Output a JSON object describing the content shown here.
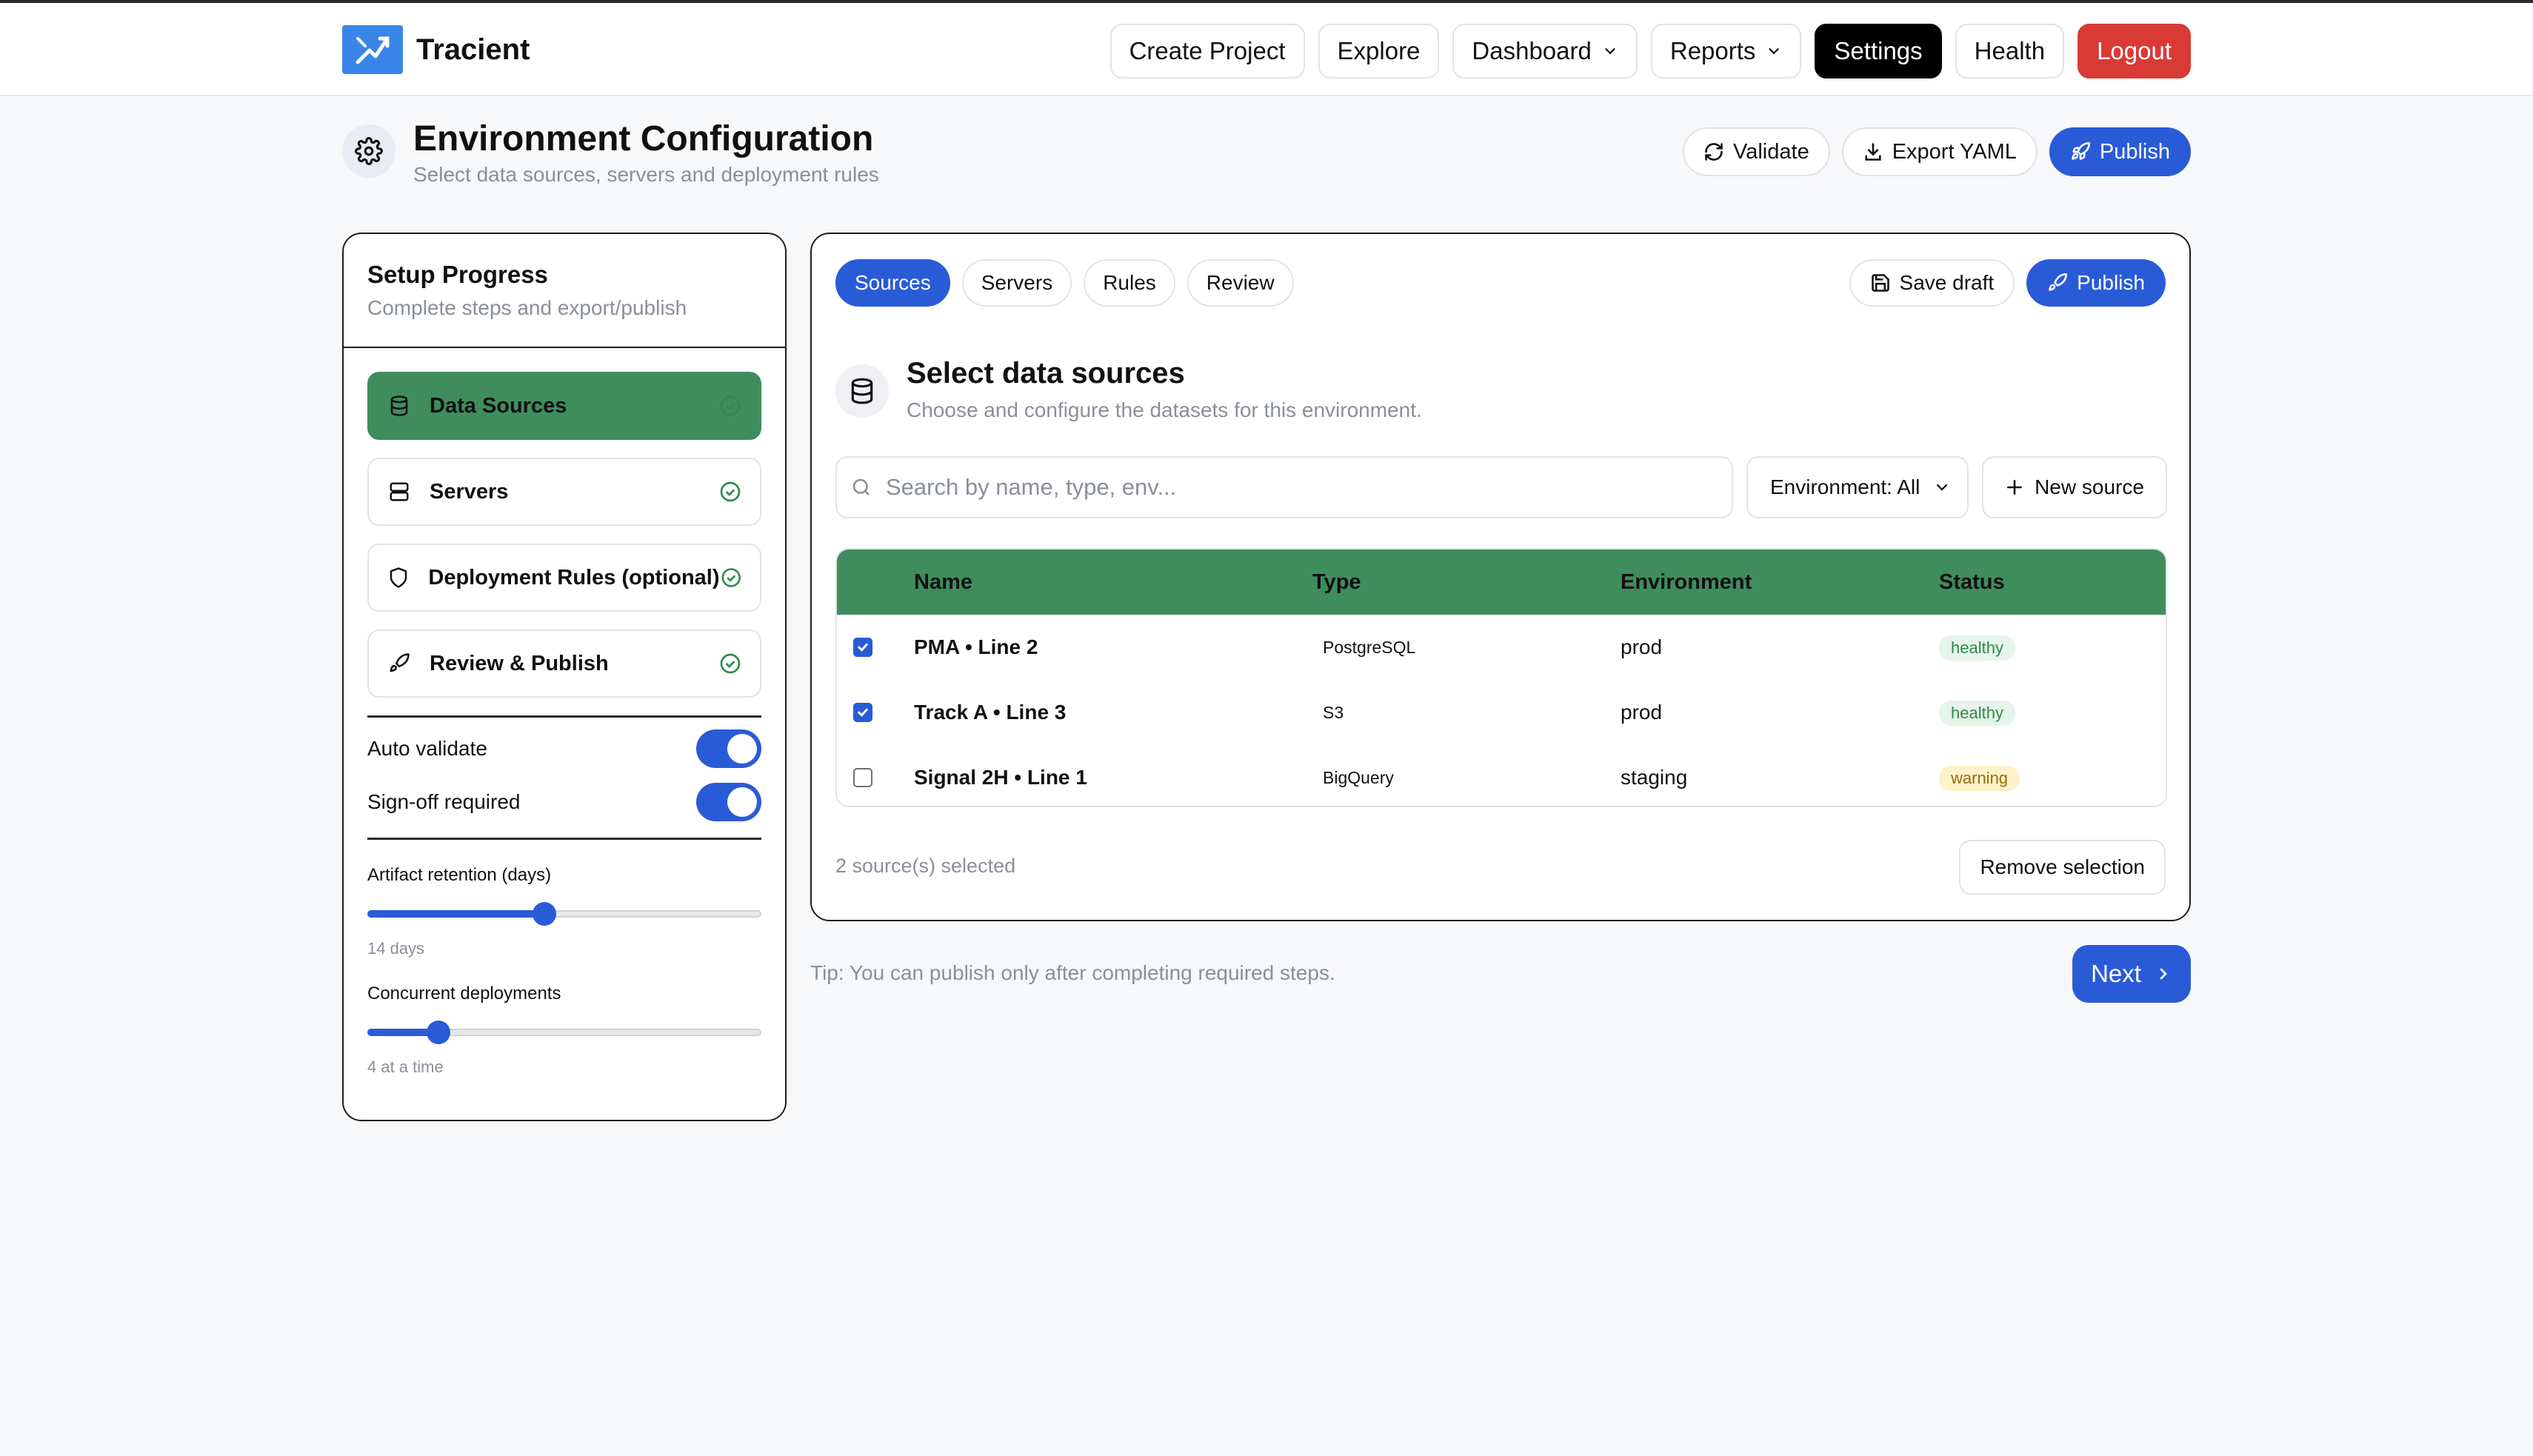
{
  "app": {
    "name": "Tracient"
  },
  "nav": {
    "create_project": "Create Project",
    "explore": "Explore",
    "dashboard": "Dashboard",
    "reports": "Reports",
    "settings": "Settings",
    "health": "Health",
    "logout": "Logout"
  },
  "page": {
    "title": "Environment Configuration",
    "subtitle": "Select data sources, servers and deployment rules",
    "actions": {
      "validate": "Validate",
      "export": "Export YAML",
      "publish": "Publish"
    }
  },
  "setup": {
    "title": "Setup Progress",
    "subtitle": "Complete steps and export/publish",
    "steps": [
      {
        "label": "Data Sources",
        "icon": "database-icon",
        "done": true,
        "active": true
      },
      {
        "label": "Servers",
        "icon": "server-icon",
        "done": true,
        "active": false
      },
      {
        "label": "Deployment Rules (optional)",
        "icon": "shield-icon",
        "done": true,
        "active": false
      },
      {
        "label": "Review & Publish",
        "icon": "rocket-icon",
        "done": true,
        "active": false
      }
    ],
    "toggles": {
      "auto_validate": "Auto validate",
      "signoff": "Sign-off required"
    },
    "retention": {
      "label": "Artifact retention (days)",
      "value_text": "14 days",
      "fraction": 0.45
    },
    "concurrent": {
      "label": "Concurrent deployments",
      "value_text": "4 at a time",
      "fraction": 0.18
    }
  },
  "main": {
    "tabs": [
      "Sources",
      "Servers",
      "Rules",
      "Review"
    ],
    "save_draft": "Save draft",
    "publish": "Publish",
    "section_title": "Select data sources",
    "section_subtitle": "Choose and configure the datasets for this environment.",
    "search_placeholder": "Search by name, type, env...",
    "env_filter": "Environment: All",
    "new_source": "New source",
    "table": {
      "headers": {
        "name": "Name",
        "type": "Type",
        "environment": "Environment",
        "status": "Status"
      },
      "rows": [
        {
          "name": "PMA • Line 2",
          "type": "PostgreSQL",
          "environment": "prod",
          "status": "healthy",
          "checked": true
        },
        {
          "name": "Track A • Line 3",
          "type": "S3",
          "environment": "prod",
          "status": "healthy",
          "checked": true
        },
        {
          "name": "Signal 2H • Line 1",
          "type": "BigQuery",
          "environment": "staging",
          "status": "warning",
          "checked": false
        }
      ]
    },
    "selected_count": "2 source(s) selected",
    "remove_selection": "Remove selection"
  },
  "footer": {
    "tip": "Tip: You can publish only after completing required steps.",
    "next": "Next"
  },
  "colors": {
    "accent": "#2a5bd7",
    "green": "#3f8d5d",
    "danger": "#d93a35"
  }
}
